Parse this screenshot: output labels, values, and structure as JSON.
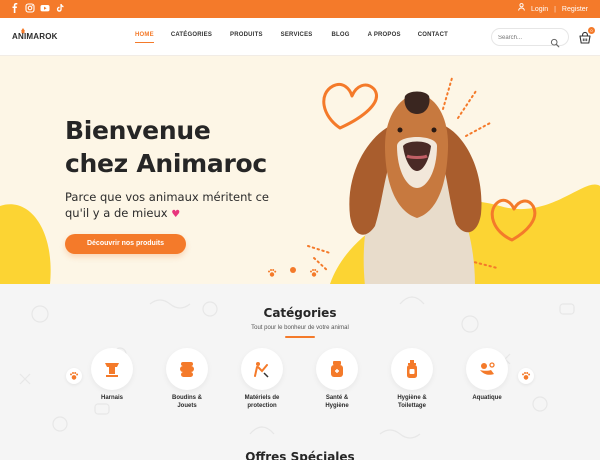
{
  "colors": {
    "accent": "#f47a2a",
    "hero_bg": "#fdf6e6",
    "hero_yellow": "#fcd433",
    "heart": "#e8357d"
  },
  "topbar": {
    "social": [
      "facebook-icon",
      "instagram-icon",
      "youtube-icon",
      "tiktok-icon"
    ],
    "login": "Login",
    "separator": "|",
    "register": "Register"
  },
  "header": {
    "logo": "ANIMAROK",
    "nav": [
      "HOME",
      "CATÉGORIES",
      "PRODUITS",
      "SERVICES",
      "BLOG",
      "A PROPOS",
      "CONTACT"
    ],
    "active_nav": "HOME",
    "search": {
      "placeholder": "Search..."
    },
    "cart_count": "0"
  },
  "hero": {
    "title_line1": "Bienvenue",
    "title_line2": "chez Animaroc",
    "subtitle_line1": "Parce que vos animaux méritent ce",
    "subtitle_line2": "qu'il y a de mieux",
    "heart": "♥",
    "cta": "Découvrir nos produits"
  },
  "categories": {
    "title": "Catégories",
    "tagline": "Tout pour le bonheur de votre animal",
    "items": [
      {
        "label_line1": "Harnais",
        "label_line2": "",
        "icon": "harness-icon"
      },
      {
        "label_line1": "Boudins &",
        "label_line2": "Jouets",
        "icon": "toy-icon"
      },
      {
        "label_line1": "Matériels de",
        "label_line2": "protection",
        "icon": "protection-icon"
      },
      {
        "label_line1": "Santé &",
        "label_line2": "Hygiène",
        "icon": "health-icon"
      },
      {
        "label_line1": "Hygiène &",
        "label_line2": "Toilettage",
        "icon": "grooming-icon"
      },
      {
        "label_line1": "Aquatique",
        "label_line2": "",
        "icon": "aquatic-icon"
      }
    ]
  },
  "next_section": {
    "title": "Offres Spéciales"
  }
}
